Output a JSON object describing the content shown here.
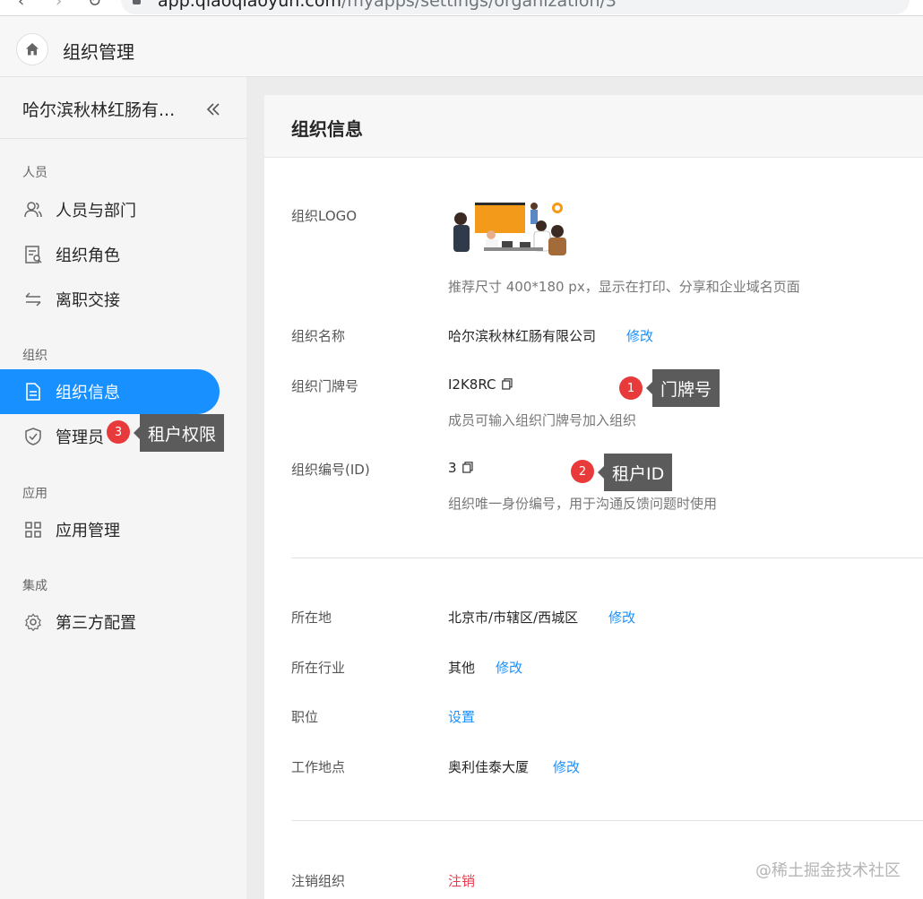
{
  "browser": {
    "url_host": "app.qiaoqiaoyun.com",
    "url_path": "/myapps/settings/organization/3"
  },
  "header": {
    "home_icon": "home-icon",
    "title": "组织管理"
  },
  "sidebar": {
    "org_name": "哈尔滨秋林红肠有...",
    "collapse_icon": "double-chevron-left-icon",
    "groups": [
      {
        "label": "人员",
        "items": [
          {
            "label": "人员与部门",
            "icon": "users-icon"
          },
          {
            "label": "组织角色",
            "icon": "role-icon"
          },
          {
            "label": "离职交接",
            "icon": "swap-icon"
          }
        ]
      },
      {
        "label": "组织",
        "items": [
          {
            "label": "组织信息",
            "icon": "document-icon",
            "active": true
          },
          {
            "label": "管理员",
            "icon": "shield-icon"
          }
        ]
      },
      {
        "label": "应用",
        "items": [
          {
            "label": "应用管理",
            "icon": "grid-icon"
          }
        ]
      },
      {
        "label": "集成",
        "items": [
          {
            "label": "第三方配置",
            "icon": "gear-icon"
          }
        ]
      }
    ]
  },
  "main": {
    "section_title": "组织信息",
    "logo": {
      "label": "组织LOGO",
      "hint": "推荐尺寸 400*180 px，显示在打印、分享和企业域名页面"
    },
    "name": {
      "label": "组织名称",
      "value": "哈尔滨秋林红肠有限公司",
      "action": "修改"
    },
    "door_number": {
      "label": "组织门牌号",
      "value": "I2K8RC",
      "hint": "成员可输入组织门牌号加入组织"
    },
    "org_id": {
      "label": "组织编号(ID)",
      "value": "3",
      "hint": "组织唯一身份编号，用于沟通反馈问题时使用"
    },
    "location": {
      "label": "所在地",
      "value": "北京市/市辖区/西城区",
      "action": "修改"
    },
    "industry": {
      "label": "所在行业",
      "value": "其他",
      "action": "修改"
    },
    "position": {
      "label": "职位",
      "action": "设置"
    },
    "workplace": {
      "label": "工作地点",
      "value": "奥利佳泰大厦",
      "action": "修改"
    },
    "cancel_org": {
      "label": "注销组织",
      "action": "注销"
    }
  },
  "annotations": [
    {
      "number": "1",
      "text": "门牌号"
    },
    {
      "number": "2",
      "text": "租户ID"
    },
    {
      "number": "3",
      "text": "租户权限"
    }
  ],
  "watermark": "@稀土掘金技术社区",
  "colors": {
    "accent": "#1890ff",
    "danger": "#e63b4c",
    "badge": "#e83a3a",
    "tooltip": "#5b5b5b"
  }
}
